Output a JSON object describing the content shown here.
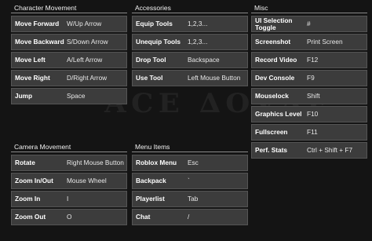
{
  "character": {
    "title": "Character Movement",
    "rows": [
      {
        "action": "Move Forward",
        "key": "W/Up Arrow"
      },
      {
        "action": "Move Backward",
        "key": "S/Down Arrow"
      },
      {
        "action": "Move Left",
        "key": "A/Left Arrow"
      },
      {
        "action": "Move Right",
        "key": "D/Right Arrow"
      },
      {
        "action": "Jump",
        "key": "Space"
      }
    ]
  },
  "camera": {
    "title": "Camera Movement",
    "rows": [
      {
        "action": "Rotate",
        "key": "Right Mouse Button"
      },
      {
        "action": "Zoom In/Out",
        "key": "Mouse Wheel"
      },
      {
        "action": "Zoom In",
        "key": "I"
      },
      {
        "action": "Zoom Out",
        "key": "O"
      }
    ]
  },
  "accessories": {
    "title": "Accessories",
    "rows": [
      {
        "action": "Equip Tools",
        "key": "1,2,3..."
      },
      {
        "action": "Unequip Tools",
        "key": "1,2,3..."
      },
      {
        "action": "Drop Tool",
        "key": "Backspace"
      },
      {
        "action": "Use Tool",
        "key": "Left Mouse Button"
      }
    ]
  },
  "menu": {
    "title": "Menu Items",
    "rows": [
      {
        "action": "Roblox Menu",
        "key": "Esc"
      },
      {
        "action": "Backpack",
        "key": "`"
      },
      {
        "action": "Playerlist",
        "key": "Tab"
      },
      {
        "action": "Chat",
        "key": "/"
      }
    ]
  },
  "misc": {
    "title": "Misc",
    "rows": [
      {
        "action": "UI Selection Toggle",
        "key": "#"
      },
      {
        "action": "Screenshot",
        "key": "Print Screen"
      },
      {
        "action": "Record Video",
        "key": "F12"
      },
      {
        "action": "Dev Console",
        "key": "F9"
      },
      {
        "action": "Mouselock",
        "key": "Shift"
      },
      {
        "action": "Graphics Level",
        "key": "F10"
      },
      {
        "action": "Fullscreen",
        "key": "F11"
      },
      {
        "action": "Perf. Stats",
        "key": "Ctrl + Shift + F7"
      }
    ]
  },
  "colors": {
    "background": "#141414",
    "row_bg": "#3c3c3c",
    "row_border": "#555555",
    "text": "#ffffff"
  }
}
